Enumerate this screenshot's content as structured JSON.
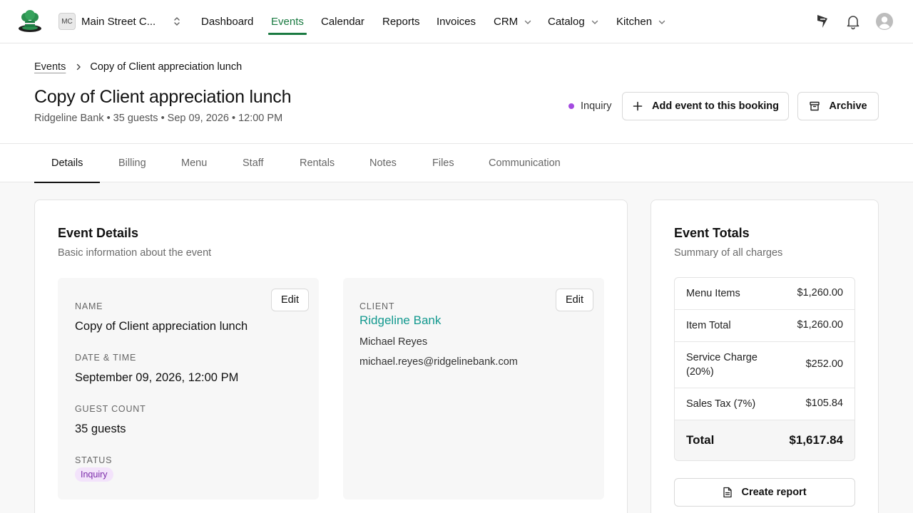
{
  "nav": {
    "org_initials": "MC",
    "org_name": "Main Street C...",
    "links": [
      "Dashboard",
      "Events",
      "Calendar",
      "Reports",
      "Invoices",
      "CRM",
      "Catalog",
      "Kitchen"
    ],
    "active_link": "Events",
    "icons": [
      "chef-hat-logo-icon",
      "up-down-chevron-icon",
      "chevron-down-icon",
      "announcement-icon",
      "bell-icon",
      "avatar-icon"
    ]
  },
  "breadcrumb": {
    "parent": "Events",
    "current": "Copy of Client appreciation lunch"
  },
  "header": {
    "title": "Copy of Client appreciation lunch",
    "subtitle": "Ridgeline Bank • 35 guests • Sep 09, 2026 • 12:00 PM",
    "status": "Inquiry",
    "add_event_label": "Add event to this booking",
    "archive_label": "Archive"
  },
  "tabs": [
    "Details",
    "Billing",
    "Menu",
    "Staff",
    "Rentals",
    "Notes",
    "Files",
    "Communication"
  ],
  "event_details": {
    "title": "Event Details",
    "subtitle": "Basic information about the event",
    "edit_label": "Edit",
    "name_label": "NAME",
    "name": "Copy of Client appreciation lunch",
    "datetime_label": "DATE & TIME",
    "datetime": "September 09, 2026, 12:00 PM",
    "guests_label": "GUEST COUNT",
    "guests": "35 guests",
    "status_label": "STATUS",
    "status": "Inquiry",
    "client_label": "CLIENT",
    "client_name": "Ridgeline Bank",
    "contact_name": "Michael Reyes",
    "contact_email": "michael.reyes@ridgelinebank.com"
  },
  "event_totals": {
    "title": "Event Totals",
    "subtitle": "Summary of all charges",
    "rows": [
      {
        "label": "Menu Items",
        "value": "$1,260.00"
      },
      {
        "label": "Item Total",
        "value": "$1,260.00"
      },
      {
        "label": "Service Charge (20%)",
        "value": "$252.00"
      },
      {
        "label": "Sales Tax (7%)",
        "value": "$105.84"
      }
    ],
    "total_label": "Total",
    "total_value": "$1,617.84",
    "create_report_label": "Create report"
  },
  "colors": {
    "accent": "#1a7a41",
    "status_purple": "#a34ae0",
    "link_teal": "#13998f"
  }
}
